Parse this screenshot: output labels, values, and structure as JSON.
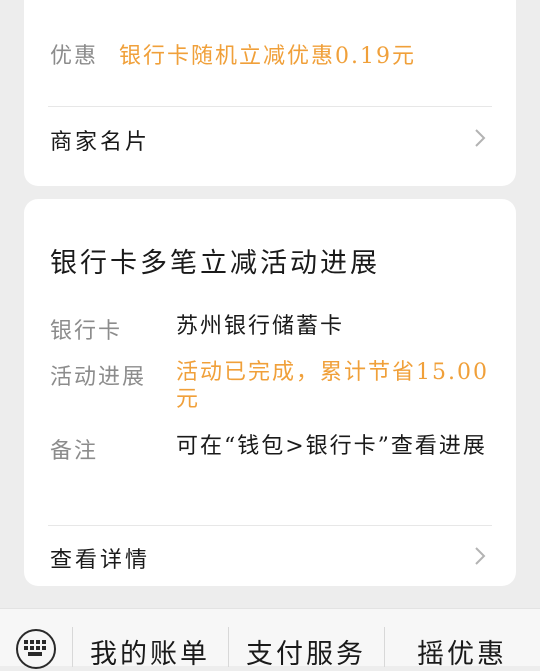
{
  "discount": {
    "label": "优惠",
    "value": "银行卡随机立减优惠0.19元"
  },
  "merchant": {
    "label": "商家名片"
  },
  "activity": {
    "title": "银行卡多笔立减活动进展",
    "rows": [
      {
        "key": "银行卡",
        "value": "苏州银行储蓄卡"
      },
      {
        "key": "活动进展",
        "value": "活动已完成，累计节省15.00元"
      },
      {
        "key": "备注",
        "value": "可在“钱包>银行卡”查看进展"
      }
    ],
    "details_label": "查看详情"
  },
  "bottom_bar": {
    "tabs": [
      "我的账单",
      "支付服务",
      "摇优惠"
    ]
  },
  "colors": {
    "accent": "#f0a03a",
    "muted": "#8c8c8c",
    "background": "#ededed"
  }
}
